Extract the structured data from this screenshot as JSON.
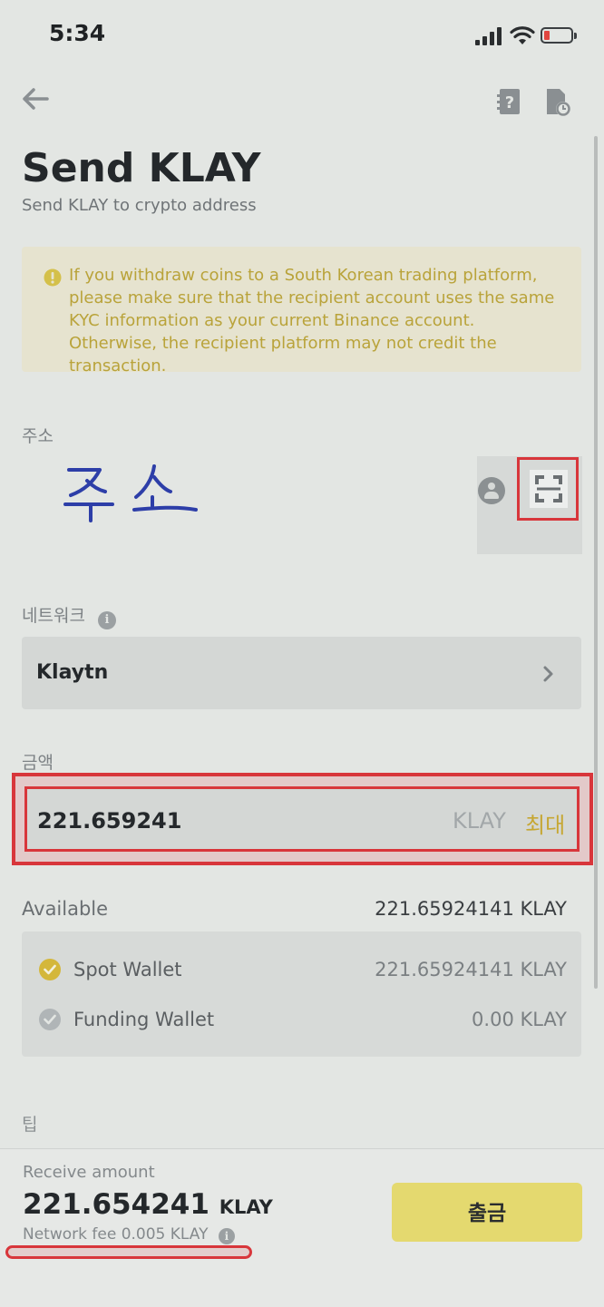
{
  "status_bar": {
    "time": "5:34"
  },
  "header": {
    "title": "Send KLAY",
    "subtitle": "Send KLAY to crypto address"
  },
  "notice": {
    "text": "If you withdraw coins to a South Korean trading platform, please make sure that the recipient account uses the same KYC information as your current Binance account. Otherwise, the recipient platform may not credit the transaction."
  },
  "address": {
    "label": "주소",
    "handwritten_value": "주소"
  },
  "network": {
    "label": "네트워크",
    "value": "Klaytn"
  },
  "amount": {
    "label": "금액",
    "value": "221.659241",
    "unit": "KLAY",
    "max_label": "최대"
  },
  "available": {
    "label": "Available",
    "value": "221.65924141 KLAY",
    "wallets": [
      {
        "name": "Spot Wallet",
        "value": "221.65924141 KLAY",
        "checked": true
      },
      {
        "name": "Funding Wallet",
        "value": "0.00 KLAY",
        "checked": false
      }
    ]
  },
  "tip": {
    "label": "팁"
  },
  "footer": {
    "receive_label": "Receive amount",
    "receive_value": "221.654241",
    "receive_unit": "KLAY",
    "network_fee": "Network fee 0.005 KLAY",
    "withdraw_label": "출금"
  },
  "colors": {
    "accent_yellow": "#e4d96f",
    "warning_text": "#b9a33a",
    "highlight_red": "#d8363b"
  }
}
